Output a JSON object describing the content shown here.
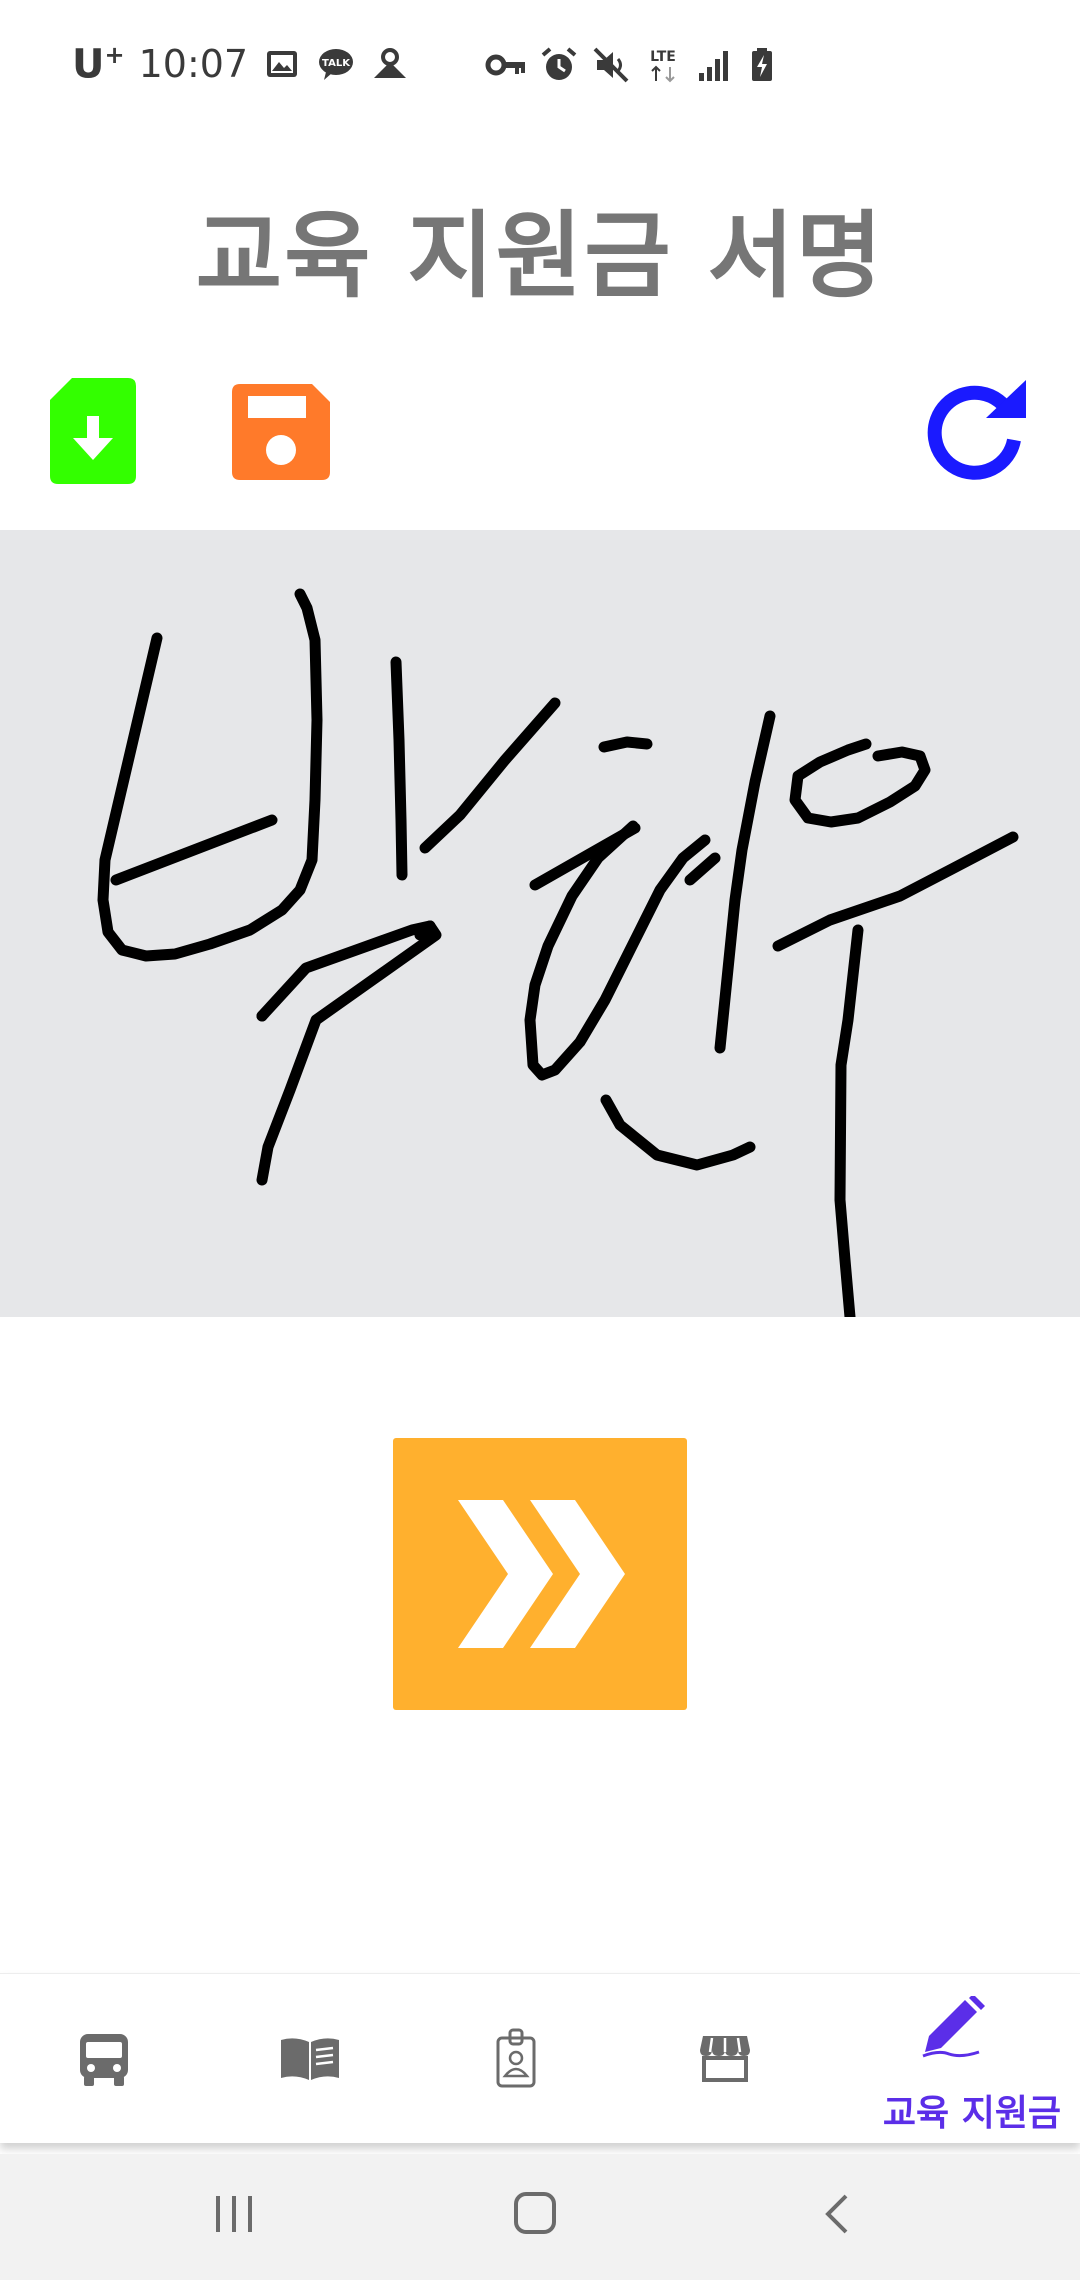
{
  "status_bar": {
    "carrier": "U",
    "carrier_sup": "+",
    "time": "10:07",
    "icons": [
      "gallery-icon",
      "kakaotalk-icon",
      "app-notification-icon",
      "vpn-key-icon",
      "alarm-icon",
      "mute-icon",
      "lte-icon",
      "signal-icon",
      "battery-charging-icon"
    ],
    "lte_label": "LTE",
    "talk_label": "TALK"
  },
  "header": {
    "title": "교육 지원금 서명"
  },
  "toolbar": {
    "export_icon": "file-download-icon",
    "save_icon": "floppy-save-icon",
    "reset_icon": "refresh-icon"
  },
  "signature": {
    "description_icon": "signature-pad"
  },
  "next": {
    "icon": "double-chevron-right-icon"
  },
  "bottom_nav": {
    "items": [
      {
        "icon": "bus-icon",
        "label": "",
        "active": false
      },
      {
        "icon": "book-icon",
        "label": "",
        "active": false
      },
      {
        "icon": "id-badge-icon",
        "label": "",
        "active": false
      },
      {
        "icon": "store-icon",
        "label": "",
        "active": false
      },
      {
        "icon": "pen-signature-icon",
        "label": "교육 지원금",
        "active": true
      }
    ]
  },
  "system_nav": {
    "items": [
      "recent-apps-icon",
      "home-icon",
      "back-icon"
    ]
  },
  "colors": {
    "title_gray": "#767676",
    "export_green": "#33ff00",
    "save_orange": "#ff7a2a",
    "reset_blue": "#1a1aff",
    "next_orange": "#ffb02e",
    "active_purple": "#5b2ee8",
    "inactive_gray": "#6b6b6b",
    "pad_gray": "#e6e7e9"
  }
}
